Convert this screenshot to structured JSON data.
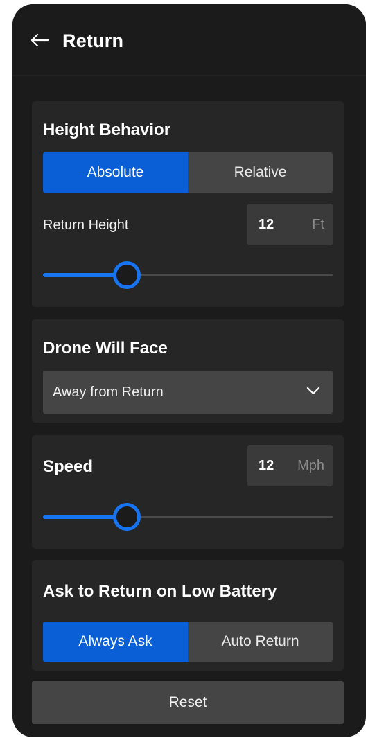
{
  "header": {
    "title": "Return",
    "back_icon": "arrow-left-icon"
  },
  "height_behavior": {
    "title": "Height Behavior",
    "options": [
      "Absolute",
      "Relative"
    ],
    "selected": "Absolute",
    "return_height_label": "Return Height",
    "return_height_value": "12",
    "return_height_unit": "Ft",
    "slider_level": 0.29
  },
  "drone_face": {
    "title": "Drone Will Face",
    "selected_value": "Away from Return",
    "chevron_icon": "chevron-down-icon"
  },
  "speed": {
    "title": "Speed",
    "value": "12",
    "unit": "Mph",
    "slider_level": 0.29
  },
  "low_battery": {
    "title": "Ask to Return on Low Battery",
    "options": [
      "Always Ask",
      "Auto Return"
    ],
    "selected": "Always Ask"
  },
  "reset": {
    "label": "Reset"
  },
  "colors": {
    "background": "#1b1b1b",
    "card": "#262626",
    "accent": "#0a5fd6",
    "slider_accent": "#1773f0",
    "control": "#454545"
  }
}
